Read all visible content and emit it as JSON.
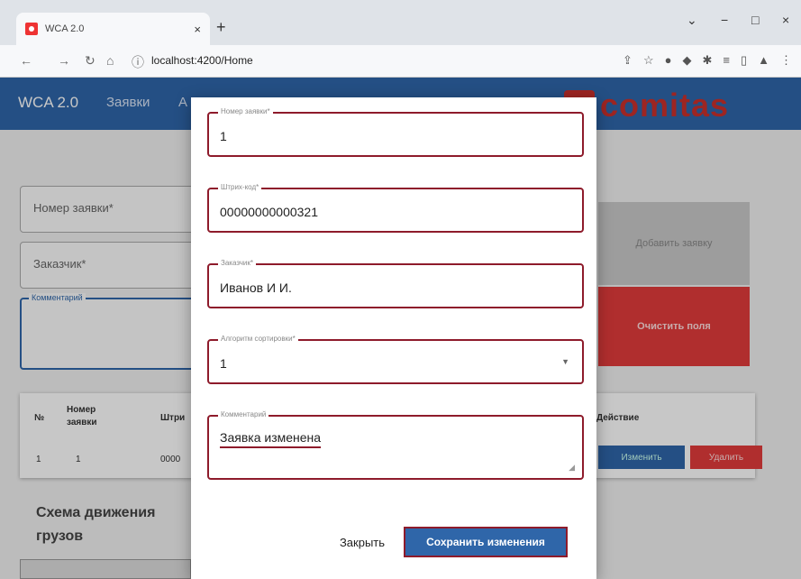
{
  "browser": {
    "tab_title": "WCA 2.0",
    "tab_close": "×",
    "new_tab": "+",
    "win_min": "−",
    "win_max": "□",
    "win_close": "×",
    "chevron": "⌄",
    "url": "localhost:4200/Home",
    "icons": [
      "share-icon",
      "star-icon",
      "extension-icon",
      "shield-icon",
      "puzzle-icon",
      "list-icon",
      "sidebar-icon",
      "profile-icon",
      "menu-icon"
    ]
  },
  "app": {
    "brand": "WCA 2.0",
    "nav": [
      "Заявки",
      "А"
    ],
    "logo_text": "comitas",
    "accent": "#2f66a9",
    "danger": "#e23b3b"
  },
  "background": {
    "order_number_label": "Номер заявки*",
    "customer_label": "Заказчик*",
    "comment_label": "Комментарий",
    "add_button": "Добавить заявку",
    "clear_button": "Очистить поля",
    "table": {
      "headers": [
        "№",
        "Номер заявки",
        "Штри",
        "Действие"
      ],
      "row": [
        "1",
        "1",
        "0000"
      ],
      "edit_button": "Изменить",
      "delete_button": "Удалить"
    },
    "scheme_title": "Схема движения грузов"
  },
  "modal": {
    "fields": [
      {
        "label": "Номер заявки*",
        "value": "1"
      },
      {
        "label": "Штрих-код*",
        "value": "00000000000321"
      },
      {
        "label": "Заказчик*",
        "value": "Иванов И И."
      },
      {
        "label": "Алгоритм сортировки*",
        "value": "1"
      },
      {
        "label": "Комментарий",
        "value": "Заявка изменена"
      }
    ],
    "close_button": "Закрыть",
    "save_button": "Сохранить изменения"
  }
}
